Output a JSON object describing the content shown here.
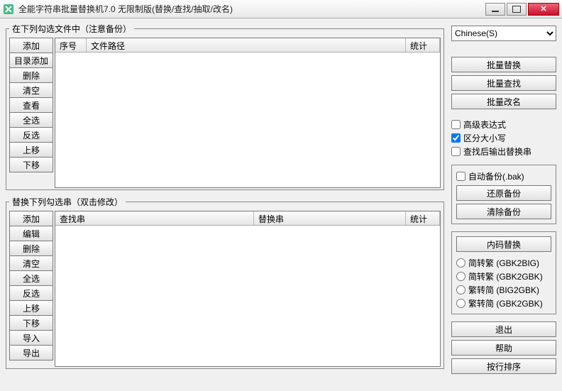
{
  "window": {
    "title": "全能字符串批量替换机7.0 无限制版(替换/查找/抽取/改名)"
  },
  "files": {
    "legend": "在下列勾选文件中（注意备份）",
    "buttons": {
      "add": "添加",
      "addDir": "目录添加",
      "del": "删除",
      "clear": "清空",
      "view": "查看",
      "selAll": "全选",
      "selInv": "反选",
      "up": "上移",
      "down": "下移"
    },
    "cols": {
      "seq": "序号",
      "path": "文件路径",
      "stat": "统计"
    }
  },
  "strings": {
    "legend": "替换下列勾选串（双击修改）",
    "buttons": {
      "add": "添加",
      "edit": "编辑",
      "del": "删除",
      "clear": "清空",
      "selAll": "全选",
      "selInv": "反选",
      "up": "上移",
      "down": "下移",
      "import": "导入",
      "export": "导出"
    },
    "cols": {
      "find": "查找串",
      "replace": "替换串",
      "stat": "统计"
    }
  },
  "side": {
    "langSelected": "Chinese(S)",
    "batchReplace": "批量替换",
    "batchFind": "批量查找",
    "batchRename": "批量改名",
    "advExpr": "高级表达式",
    "caseSensitive": "区分大小写",
    "outputAfterFind": "查找后输出替换串",
    "autoBackup": "自动备份(.bak)",
    "restore": "还原备份",
    "clearBackup": "清除备份",
    "encodingTitle": "内码替换",
    "enc1": "简转繁 (GBK2BIG)",
    "enc2": "简转繁 (GBK2GBK)",
    "enc3": "繁转简 (BIG2GBK)",
    "enc4": "繁转简 (GBK2GBK)",
    "exit": "退出",
    "help": "帮助",
    "sortByLine": "按行排序"
  }
}
